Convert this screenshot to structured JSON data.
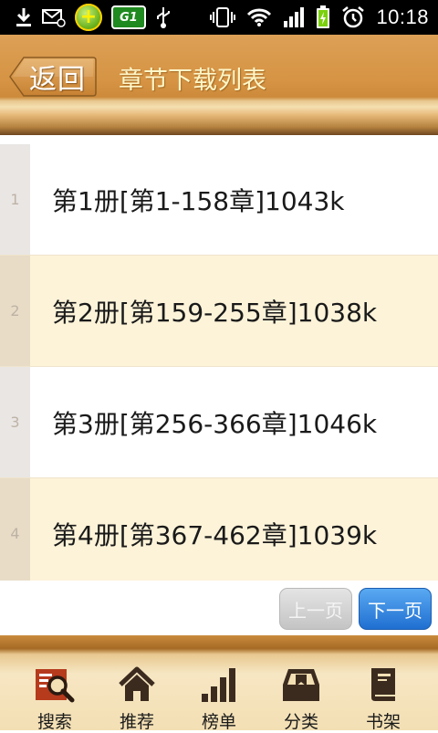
{
  "status_bar": {
    "time": "10:18",
    "sim_label": "G1",
    "icons": [
      "download-icon",
      "mail-icon",
      "plus-badge-icon",
      "sim-icon",
      "usb-icon",
      "vibrate-icon",
      "wifi-icon",
      "signal-icon",
      "battery-icon",
      "alarm-icon"
    ]
  },
  "header": {
    "back_label": "返回",
    "title": "章节下载列表"
  },
  "list": {
    "items": [
      {
        "index": "1",
        "title": "第1册[第1-158章]1043k"
      },
      {
        "index": "2",
        "title": "第2册[第159-255章]1038k"
      },
      {
        "index": "3",
        "title": "第3册[第256-366章]1046k"
      },
      {
        "index": "4",
        "title": "第4册[第367-462章]1039k"
      }
    ]
  },
  "pager": {
    "prev_label": "上一页",
    "next_label": "下一页"
  },
  "bottom_nav": {
    "items": [
      {
        "label": "搜索",
        "icon": "search-icon"
      },
      {
        "label": "推荐",
        "icon": "home-icon"
      },
      {
        "label": "榜单",
        "icon": "ranking-icon"
      },
      {
        "label": "分类",
        "icon": "category-icon"
      },
      {
        "label": "书架",
        "icon": "bookshelf-icon"
      }
    ]
  },
  "colors": {
    "header_gold": "#d69444",
    "title_text": "#fff7c9",
    "row_alt": "#fdf3d9",
    "next_button": "#1f6fd1"
  }
}
